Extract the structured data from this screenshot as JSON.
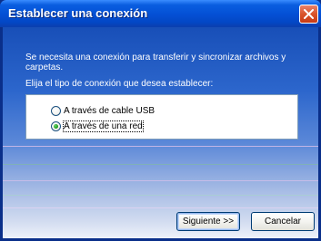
{
  "window": {
    "title": "Establecer una conexión"
  },
  "content": {
    "description": "Se necesita una conexión para transferir y sincronizar archivos y carpetas.",
    "prompt": "Elija el tipo de conexión que desea establecer:",
    "options": [
      {
        "label": "A través de cable USB",
        "selected": false
      },
      {
        "label": "A través de una red",
        "selected": true
      }
    ]
  },
  "buttons": {
    "next": "Siguiente >>",
    "cancel": "Cancelar"
  },
  "colors": {
    "titlebar": "#0451d6",
    "close_button": "#d9542a",
    "radio_selected": "#21a121"
  },
  "icons": {
    "close": "close-x-icon"
  }
}
